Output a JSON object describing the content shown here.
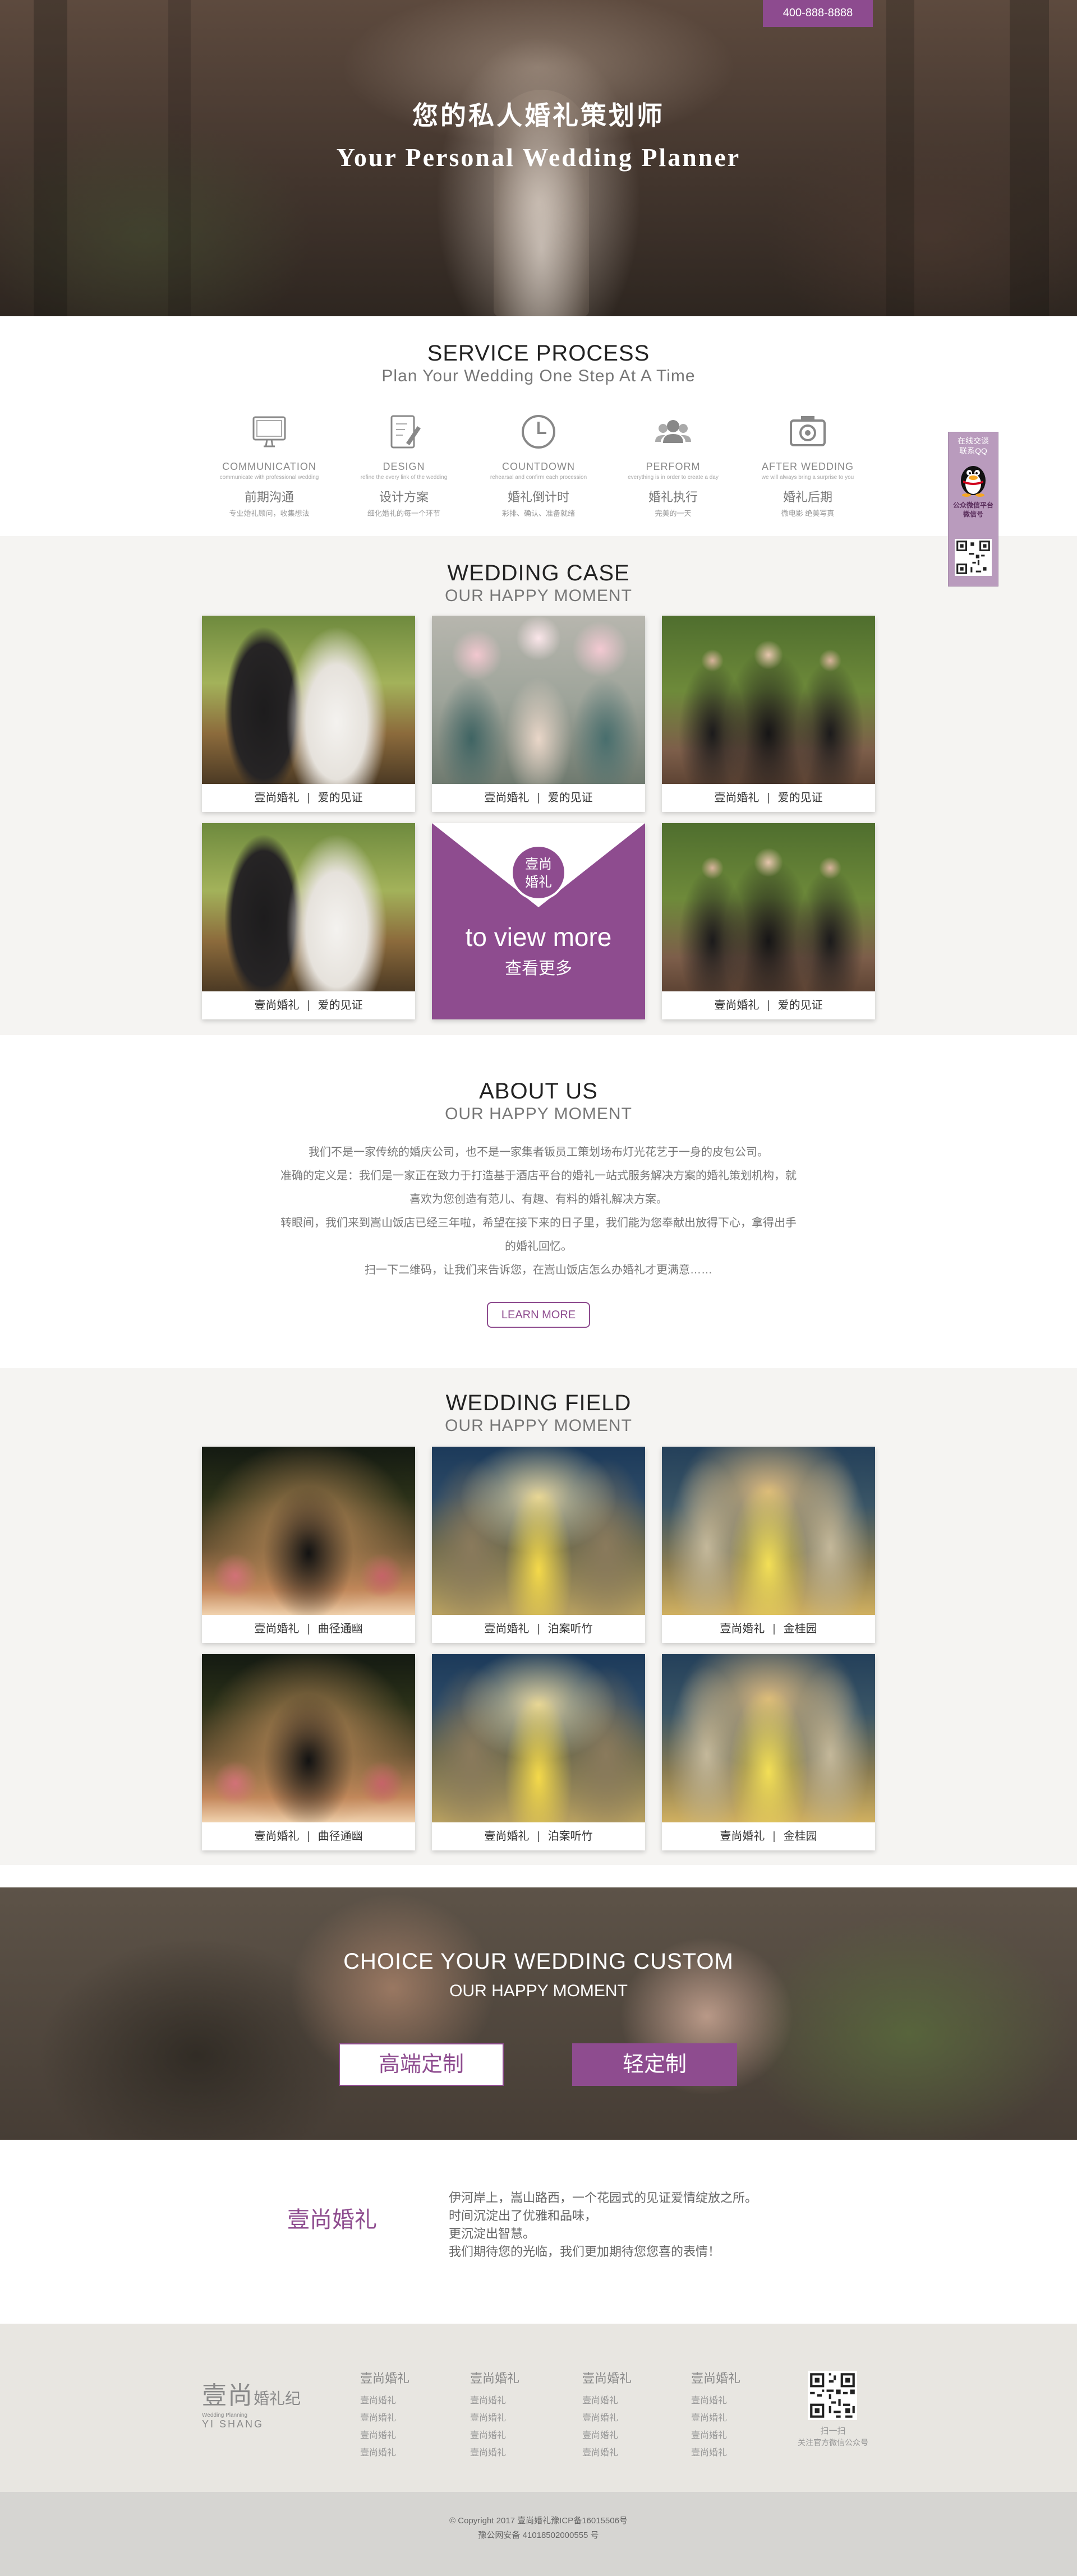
{
  "hero": {
    "phone": "400-888-8888",
    "title_cn": "您的私人婚礼策划师",
    "title_en": "Your Personal Wedding Planner"
  },
  "process": {
    "title": "SERVICE PROCESS",
    "subtitle": "Plan Your Wedding One Step At A Time",
    "steps": [
      {
        "icon": "monitor-icon",
        "en": "COMMUNICATION",
        "en_sub": "communicate with professional wedding",
        "cn": "前期沟通",
        "desc": "专业婚礼顾问，收集想法"
      },
      {
        "icon": "pencil-notepad-icon",
        "en": "DESIGN",
        "en_sub": "refine the every link of the wedding",
        "cn": "设计方案",
        "desc": "细化婚礼的每一个环节"
      },
      {
        "icon": "clock-icon",
        "en": "COUNTDOWN",
        "en_sub": "rehearsal and confirm each procession",
        "cn": "婚礼倒计时",
        "desc": "彩排、确认、准备就绪"
      },
      {
        "icon": "people-icon",
        "en": "PERFORM",
        "en_sub": "everything is in order to create a day",
        "cn": "婚礼执行",
        "desc": "完美的一天"
      },
      {
        "icon": "camera-icon",
        "en": "AFTER WEDDING",
        "en_sub": "we will always bring a surprise to you",
        "cn": "婚礼后期",
        "desc": "微电影 绝美写真"
      }
    ]
  },
  "cases": {
    "title": "WEDDING CASE",
    "subtitle": "OUR HAPPY MOMENT",
    "items": [
      {
        "brand": "壹尚婚礼",
        "label": "爱的见证",
        "photo": "couple"
      },
      {
        "brand": "壹尚婚礼",
        "label": "爱的见证",
        "photo": "bridesmaids"
      },
      {
        "brand": "壹尚婚礼",
        "label": "爱的见证",
        "photo": "groomsmen"
      },
      {
        "brand": "壹尚婚礼",
        "label": "爱的见证",
        "photo": "couple"
      },
      {
        "brand": "壹尚婚礼",
        "label": "爱的见证",
        "photo": "groomsmen"
      }
    ],
    "more": {
      "seal_line1": "壹尚",
      "seal_line2": "婚礼",
      "en": "to view more",
      "cn": "查看更多"
    }
  },
  "about": {
    "title": "ABOUT  US",
    "subtitle": "OUR HAPPY MOMENT",
    "p1": "我们不是一家传统的婚庆公司，也不是一家集者钣员工策划场布灯光花艺于一身的皮包公司。",
    "p2": "准确的定义是：我们是一家正在致力于打造基于酒店平台的婚礼一站式服务解决方案的婚礼策划机构，就喜欢为您创造有范儿、有趣、有料的婚礼解决方案。",
    "p3": "转眼间，我们来到嵩山饭店已经三年啦，希望在接下来的日子里，我们能为您奉献出放得下心，拿得出手的婚礼回忆。",
    "p4": "扫一下二维码，让我们来告诉您，在嵩山饭店怎么办婚礼才更满意……",
    "button": "LEARN MORE"
  },
  "field": {
    "title": "WEDDING FIELD",
    "subtitle": "OUR HAPPY MOMENT",
    "items": [
      {
        "brand": "壹尚婚礼",
        "label": "曲径通幽",
        "photo": "arch"
      },
      {
        "brand": "壹尚婚礼",
        "label": "泊案听竹",
        "photo": "aisle"
      },
      {
        "brand": "壹尚婚礼",
        "label": "金桂园",
        "photo": "stage"
      },
      {
        "brand": "壹尚婚礼",
        "label": "曲径通幽",
        "photo": "arch"
      },
      {
        "brand": "壹尚婚礼",
        "label": "泊案听竹",
        "photo": "aisle"
      },
      {
        "brand": "壹尚婚礼",
        "label": "金桂园",
        "photo": "stage"
      }
    ]
  },
  "custom": {
    "title": "CHOICE YOUR WEDDING CUSTOM",
    "subtitle": "OUR HAPPY MOMENT",
    "btn_high": "高端定制",
    "btn_light": "轻定制"
  },
  "brand": {
    "name": "壹尚婚礼",
    "line1": "伊河岸上，嵩山路西，一个花园式的见证爱情绽放之所。",
    "line2": "时间沉淀出了优雅和品味，",
    "line3": "更沉淀出智慧。",
    "line4": "我们期待您的光临，我们更加期待您您喜的表情！"
  },
  "footer": {
    "logo_cn": "壹尚",
    "logo_cn2": "婚礼纪",
    "logo_small": "Wedding Planning",
    "logo_en": "YI SHANG",
    "columns": [
      {
        "head": "壹尚婚礼",
        "items": [
          "壹尚婚礼",
          "壹尚婚礼",
          "壹尚婚礼",
          "壹尚婚礼"
        ]
      },
      {
        "head": "壹尚婚礼",
        "items": [
          "壹尚婚礼",
          "壹尚婚礼",
          "壹尚婚礼",
          "壹尚婚礼"
        ]
      },
      {
        "head": "壹尚婚礼",
        "items": [
          "壹尚婚礼",
          "壹尚婚礼",
          "壹尚婚礼",
          "壹尚婚礼"
        ]
      },
      {
        "head": "壹尚婚礼",
        "items": [
          "壹尚婚礼",
          "壹尚婚礼",
          "壹尚婚礼",
          "壹尚婚礼"
        ]
      }
    ],
    "qr_caption1": "扫一扫",
    "qr_caption2": "关注官方微信公众号",
    "copyright": "© Copyright 2017 壹尚婚礼豫ICP备16015506号",
    "record": "豫公网安备 41018502000555 号"
  },
  "float": {
    "line1": "在线交谈",
    "line2": "联系QQ",
    "line3": "公众微信平台",
    "line4": "微信号"
  },
  "colors": {
    "accent": "#8e4c8f",
    "grey_band": "#f5f4f2",
    "footer": "#e8e6e1",
    "copyright_bar": "#d6d5d2"
  }
}
